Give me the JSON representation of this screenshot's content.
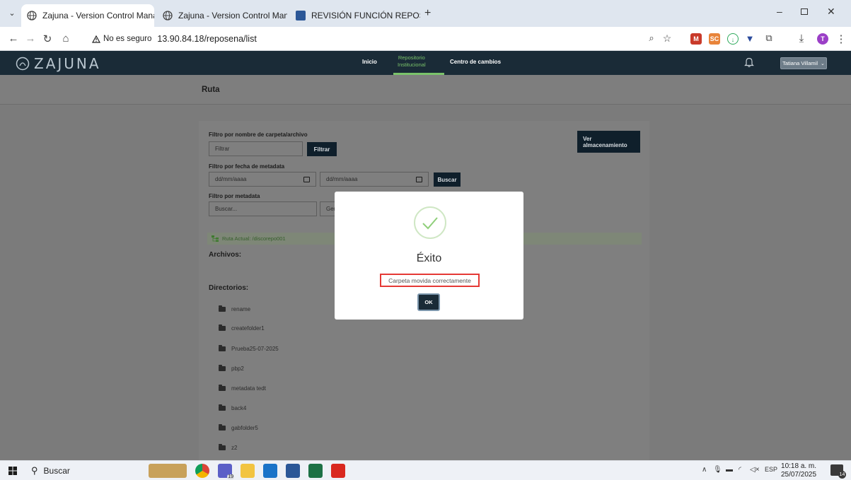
{
  "browser": {
    "tabs": [
      {
        "title": "Zajuna - Version Control Manag",
        "active": true
      },
      {
        "title": "Zajuna - Version Control Manag",
        "active": false
      },
      {
        "title": "REVISIÓN FUNCIÓN REPOSITOI",
        "active": false
      }
    ],
    "new_tab": "+",
    "security_label": "No es seguro",
    "url": "13.90.84.18/reposena/list"
  },
  "app": {
    "logo_text": "ZAJUNA",
    "nav": {
      "inicio": "Inicio",
      "repo_line1": "Repositorio",
      "repo_line2": "Institucional",
      "cambios": "Centro de cambios"
    },
    "user": "Tatiana Villamil"
  },
  "page": {
    "route_title": "Ruta",
    "filter_name_label": "Filtro por nombre de carpeta/archivo",
    "filter_name_placeholder": "Filtrar",
    "filter_name_button": "Filtrar",
    "storage_button_line1": "Ver",
    "storage_button_line2": "almacenamiento",
    "filter_date_label": "Filtro por fecha de metadata",
    "date_from_placeholder": "dd/mm/aaaa",
    "date_to_placeholder": "dd/mm/aaaa",
    "date_search_button": "Buscar",
    "filter_meta_label": "Filtro por metadata",
    "meta_placeholder": "Buscar...",
    "meta_select_partial": "Ger",
    "current_route": "Ruta Actual: /discorepo001",
    "files_heading": "Archivos:",
    "dirs_heading": "Directorios:",
    "directories": [
      "rename",
      "createfolder1",
      "Prueba25-07-2025",
      "pbp2",
      "metadata tedt",
      "back4",
      "gabfolder5",
      "z2"
    ]
  },
  "modal": {
    "title": "Éxito",
    "message": "Carpeta movida correctamente",
    "ok_label": "OK"
  },
  "taskbar": {
    "search_label": "Buscar",
    "teams_badge": "19",
    "language": "ESP",
    "time": "10:18 a. m.",
    "date": "25/07/2025",
    "notification_count": "14"
  }
}
